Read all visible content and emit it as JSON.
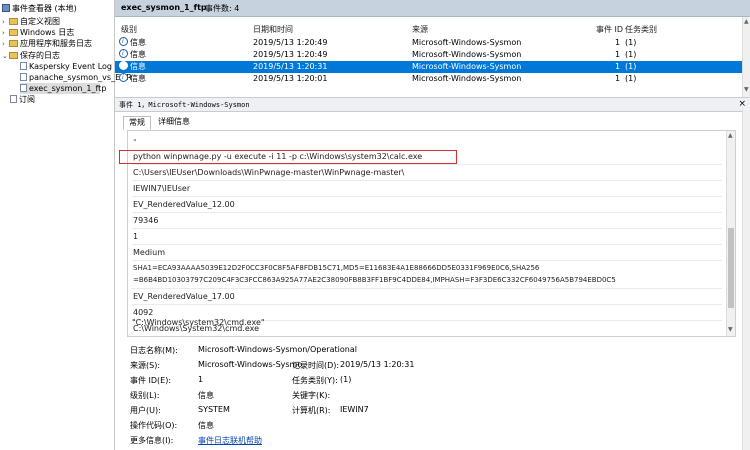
{
  "tree": {
    "root": "事件查看器 (本地)",
    "items": [
      "自定义视图",
      "Windows 日志",
      "应用程序和服务日志",
      "保存的日志",
      "Kaspersky Event Log",
      "panache_sysmon_vs_EDR",
      "exec_sysmon_1_ftp",
      "订阅"
    ]
  },
  "header": {
    "title": "exec_sysmon_1_ftp",
    "count": "事件数: 4"
  },
  "columns": [
    "级别",
    "日期和时间",
    "来源",
    "事件 ID",
    "任务类别"
  ],
  "events": [
    {
      "level": "信息",
      "datetime": "2019/5/13 1:20:49",
      "source": "Microsoft-Windows-Sysmon",
      "id": "1",
      "category": "(1)"
    },
    {
      "level": "信息",
      "datetime": "2019/5/13 1:20:49",
      "source": "Microsoft-Windows-Sysmon",
      "id": "1",
      "category": "(1)"
    },
    {
      "level": "信息",
      "datetime": "2019/5/13 1:20:31",
      "source": "Microsoft-Windows-Sysmon",
      "id": "1",
      "category": "(1)"
    },
    {
      "level": "信息",
      "datetime": "2019/5/13 1:20:01",
      "source": "Microsoft-Windows-Sysmon",
      "id": "1",
      "category": "(1)"
    }
  ],
  "detail": {
    "title": "事件 1，Microsoft-Windows-Sysmon",
    "close": "×",
    "tabs": [
      "常规",
      "详细信息"
    ],
    "lines": [
      "python  winpwnage.py -u execute -i 11 -p c:\\Windows\\system32\\calc.exe",
      "C:\\Users\\IEUser\\Downloads\\WinPwnage-master\\WinPwnage-master\\",
      "IEWIN7\\IEUser",
      "EV_RenderedValue_12.00",
      "79346",
      "1",
      "Medium",
      "SHA1=ECA93AAAA5039E12D2F0CC3F0C8F5AF8FDB15C71,MD5=E11683E4A1E88666DD5E0331F969E0C6,SHA256",
      "=B6B4BD10303797C209C4F3C3FCC863A925A77AE2C38090FB8B3FF1BF9C4DDE84,IMPHASH=F3F3DE6C332CF6049756A5B794EBD0C5",
      "EV_RenderedValue_17.00",
      "4092",
      "C:\\Windows\\System32\\cmd.exe",
      "\"C:\\Windows\\system32\\cmd.exe\""
    ],
    "props": {
      "log_name_label": "日志名称(M):",
      "log_name": "Microsoft-Windows-Sysmon/Operational",
      "source_label": "来源(S):",
      "source": "Microsoft-Windows-Sysmo",
      "logged_label": "记录时间(D):",
      "logged": "2019/5/13 1:20:31",
      "event_id_label": "事件 ID(E):",
      "event_id": "1",
      "task_label": "任务类别(Y):",
      "task": "(1)",
      "level_label": "级别(L):",
      "level": "信息",
      "keywords_label": "关键字(K):",
      "keywords": "",
      "user_label": "用户(U):",
      "user": "SYSTEM",
      "computer_label": "计算机(R):",
      "computer": "IEWIN7",
      "opcode_label": "操作代码(O):",
      "opcode": "信息",
      "more_label": "更多信息(I):",
      "more_link": "事件日志联机帮助"
    }
  }
}
